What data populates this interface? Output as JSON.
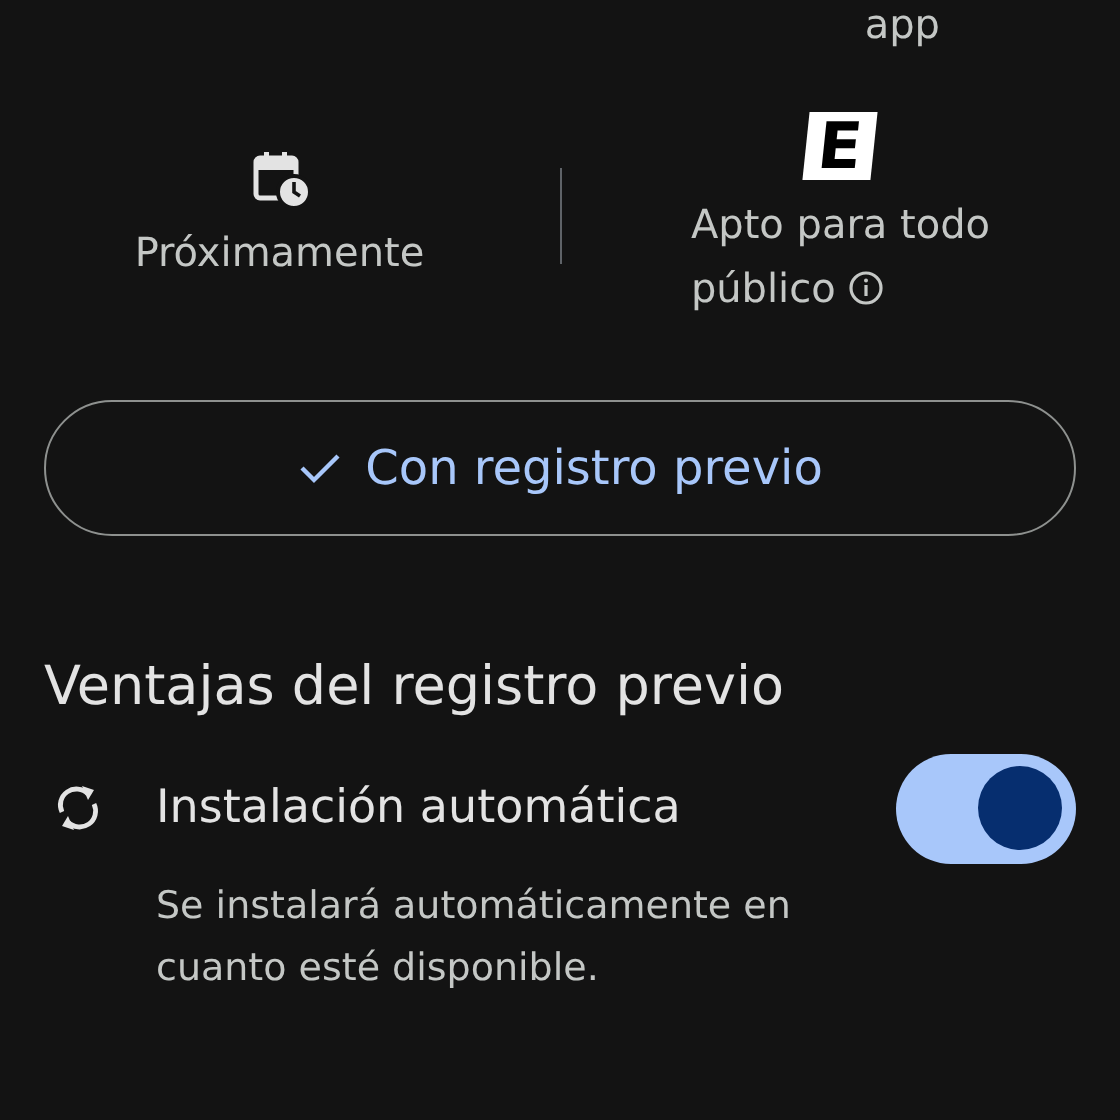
{
  "top_label": "app",
  "stats": [
    {
      "kind": "calendar",
      "lines": [
        "Próximamente"
      ]
    },
    {
      "kind": "rating",
      "badge": "E",
      "lines": [
        "Apto para todo",
        "público"
      ],
      "info": true
    }
  ],
  "preregister_button": {
    "label": "Con registro previo",
    "checked": true
  },
  "section": {
    "title": "Ventajas del registro previo",
    "items": [
      {
        "label": "Instalación automática",
        "description": "Se instalará automáticamente en cuanto esté disponible.",
        "on": true
      }
    ]
  }
}
